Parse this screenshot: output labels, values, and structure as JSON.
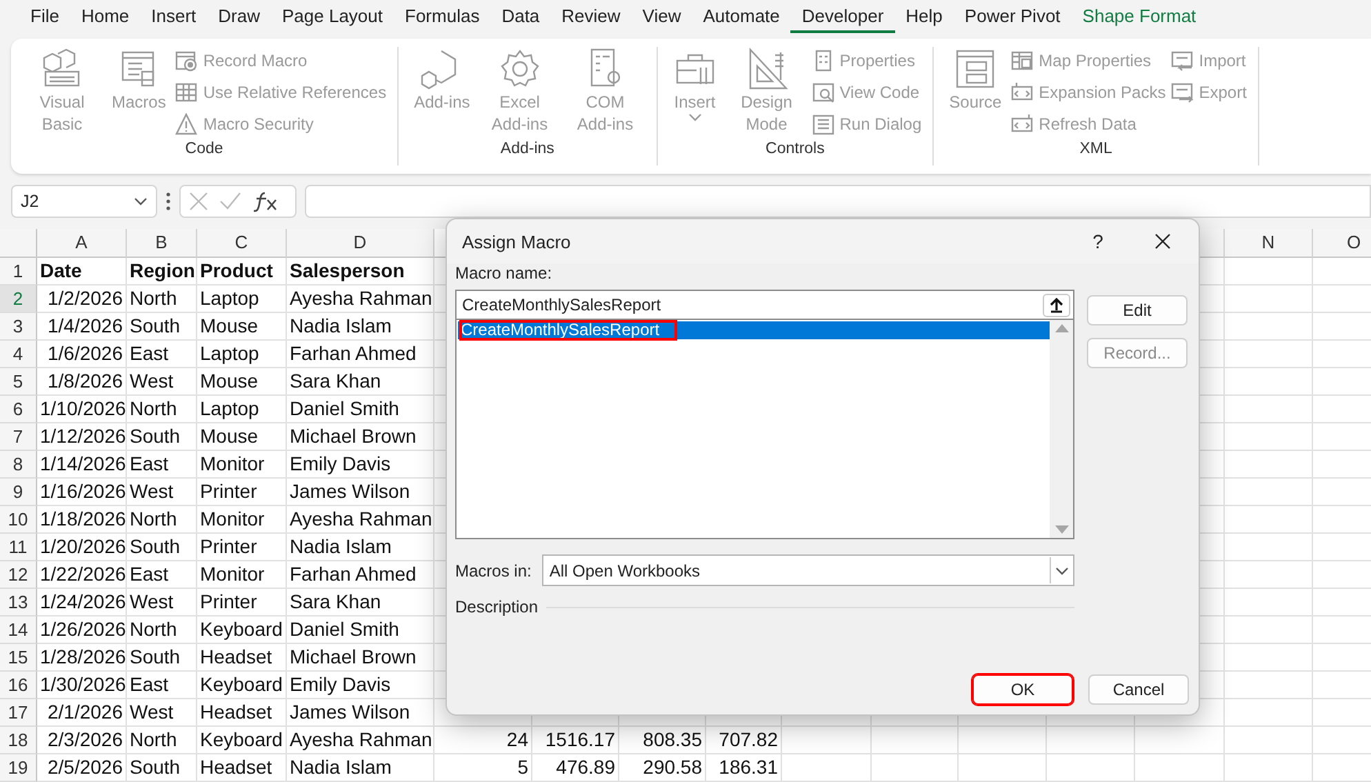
{
  "menu_tabs": [
    {
      "label": "File",
      "selected": false,
      "kind": "normal"
    },
    {
      "label": "Home",
      "selected": false,
      "kind": "normal"
    },
    {
      "label": "Insert",
      "selected": false,
      "kind": "normal"
    },
    {
      "label": "Draw",
      "selected": false,
      "kind": "normal"
    },
    {
      "label": "Page Layout",
      "selected": false,
      "kind": "normal"
    },
    {
      "label": "Formulas",
      "selected": false,
      "kind": "normal"
    },
    {
      "label": "Data",
      "selected": false,
      "kind": "normal"
    },
    {
      "label": "Review",
      "selected": false,
      "kind": "normal"
    },
    {
      "label": "View",
      "selected": false,
      "kind": "normal"
    },
    {
      "label": "Automate",
      "selected": false,
      "kind": "normal"
    },
    {
      "label": "Developer",
      "selected": true,
      "kind": "normal"
    },
    {
      "label": "Help",
      "selected": false,
      "kind": "normal"
    },
    {
      "label": "Power Pivot",
      "selected": false,
      "kind": "normal"
    },
    {
      "label": "Shape Format",
      "selected": false,
      "kind": "contextual"
    }
  ],
  "ribbon_groups": [
    {
      "label": "Code",
      "items": [
        {
          "label": "Visual Basic",
          "kind": "large"
        },
        {
          "label": "Macros",
          "kind": "large"
        },
        {
          "label": "Record Macro",
          "kind": "small"
        },
        {
          "label": "Use Relative References",
          "kind": "small"
        },
        {
          "label": "Macro Security",
          "kind": "small"
        }
      ]
    },
    {
      "label": "Add-ins",
      "items": [
        {
          "label": "Add-ins",
          "kind": "large"
        },
        {
          "label": "Excel Add-ins",
          "kind": "large"
        },
        {
          "label": "COM Add-ins",
          "kind": "large"
        }
      ]
    },
    {
      "label": "Controls",
      "items": [
        {
          "label": "Insert",
          "kind": "dropdown"
        },
        {
          "label": "Design Mode",
          "kind": "large"
        },
        {
          "label": "Properties",
          "kind": "small"
        },
        {
          "label": "View Code",
          "kind": "small"
        },
        {
          "label": "Run Dialog",
          "kind": "small"
        }
      ]
    },
    {
      "label": "XML",
      "items": [
        {
          "label": "Source",
          "kind": "large"
        },
        {
          "label": "Map Properties",
          "kind": "small"
        },
        {
          "label": "Expansion Packs",
          "kind": "small"
        },
        {
          "label": "Refresh Data",
          "kind": "small"
        },
        {
          "label": "Import",
          "kind": "small"
        },
        {
          "label": "Export",
          "kind": "small"
        }
      ]
    }
  ],
  "formula_bar": {
    "name_box": "J2"
  },
  "sheet": {
    "columns": [
      "A",
      "B",
      "C",
      "D",
      "N",
      "O"
    ],
    "rows": [
      {
        "number": "1",
        "selected": false,
        "cells": [
          "Date",
          "Region",
          "Product",
          "Salesperson"
        ]
      },
      {
        "number": "2",
        "selected": true,
        "cells": [
          "1/2/2026",
          "North",
          "Laptop",
          "Ayesha Rahman"
        ]
      },
      {
        "number": "3",
        "selected": false,
        "cells": [
          "1/4/2026",
          "South",
          "Mouse",
          "Nadia Islam"
        ]
      },
      {
        "number": "4",
        "selected": false,
        "cells": [
          "1/6/2026",
          "East",
          "Laptop",
          "Farhan Ahmed"
        ]
      },
      {
        "number": "5",
        "selected": false,
        "cells": [
          "1/8/2026",
          "West",
          "Mouse",
          "Sara Khan"
        ]
      },
      {
        "number": "6",
        "selected": false,
        "cells": [
          "1/10/2026",
          "North",
          "Laptop",
          "Daniel Smith"
        ]
      },
      {
        "number": "7",
        "selected": false,
        "cells": [
          "1/12/2026",
          "South",
          "Mouse",
          "Michael Brown"
        ]
      },
      {
        "number": "8",
        "selected": false,
        "cells": [
          "1/14/2026",
          "East",
          "Monitor",
          "Emily Davis"
        ]
      },
      {
        "number": "9",
        "selected": false,
        "cells": [
          "1/16/2026",
          "West",
          "Printer",
          "James Wilson"
        ]
      },
      {
        "number": "10",
        "selected": false,
        "cells": [
          "1/18/2026",
          "North",
          "Monitor",
          "Ayesha Rahman"
        ]
      },
      {
        "number": "11",
        "selected": false,
        "cells": [
          "1/20/2026",
          "South",
          "Printer",
          "Nadia Islam"
        ]
      },
      {
        "number": "12",
        "selected": false,
        "cells": [
          "1/22/2026",
          "East",
          "Monitor",
          "Farhan Ahmed"
        ]
      },
      {
        "number": "13",
        "selected": false,
        "cells": [
          "1/24/2026",
          "West",
          "Printer",
          "Sara Khan"
        ]
      },
      {
        "number": "14",
        "selected": false,
        "cells": [
          "1/26/2026",
          "North",
          "Keyboard",
          "Daniel Smith"
        ]
      },
      {
        "number": "15",
        "selected": false,
        "cells": [
          "1/28/2026",
          "South",
          "Headset",
          "Michael Brown"
        ]
      },
      {
        "number": "16",
        "selected": false,
        "cells": [
          "1/30/2026",
          "East",
          "Keyboard",
          "Emily Davis"
        ]
      },
      {
        "number": "17",
        "selected": false,
        "cells": [
          "2/1/2026",
          "West",
          "Headset",
          "James Wilson"
        ]
      },
      {
        "number": "18",
        "selected": false,
        "cells": [
          "2/3/2026",
          "North",
          "Keyboard",
          "Ayesha Rahman",
          "24",
          "1516.17",
          "808.35",
          "707.82"
        ]
      },
      {
        "number": "19",
        "selected": false,
        "cells": [
          "2/5/2026",
          "South",
          "Headset",
          "Nadia Islam",
          "5",
          "476.89",
          "290.58",
          "186.31"
        ]
      }
    ]
  },
  "dialog": {
    "title": "Assign Macro",
    "help": "?",
    "macro_name_label": "Macro name:",
    "macro_name_value": "CreateMonthlySalesReport",
    "macros": [
      {
        "label": "CreateMonthlySalesReport",
        "selected": true,
        "highlighted": true
      }
    ],
    "side_buttons": [
      {
        "label": "Edit",
        "disabled": false
      },
      {
        "label": "Record...",
        "disabled": true
      }
    ],
    "macros_in_label": "Macros in:",
    "macros_in_value": "All Open Workbooks",
    "description_label": "Description",
    "footer_buttons": [
      {
        "label": "OK",
        "highlighted": true
      },
      {
        "label": "Cancel",
        "highlighted": false
      }
    ]
  }
}
